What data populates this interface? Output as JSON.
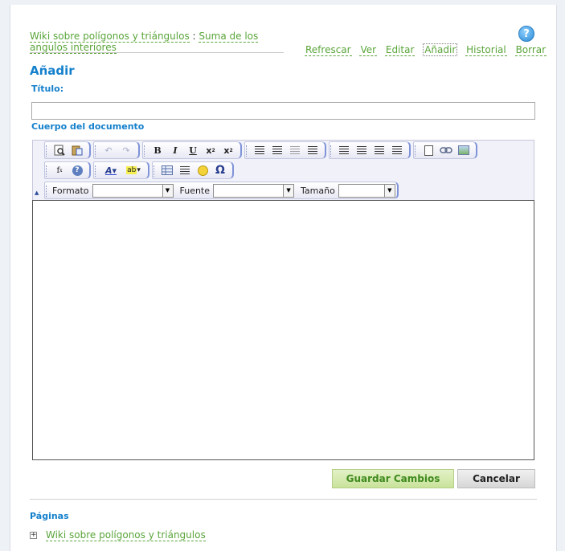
{
  "breadcrumb": {
    "wiki_link": "Wiki sobre polígonos y triángulos",
    "separator": ":",
    "page_link": "Suma de los angulos interiores"
  },
  "actions": [
    "Refrescar",
    "Ver",
    "Editar",
    "Añadir",
    "Historial",
    "Borrar"
  ],
  "active_action": "Añadir",
  "help_icon": "?",
  "heading": "Añadir",
  "title_label": "Título:",
  "title_value": "",
  "body_label": "Cuerpo del documento",
  "toolbar": {
    "icons_row1": [
      "preview-icon",
      "paste-word-icon",
      "undo-icon",
      "redo-icon",
      "bold-icon",
      "italic-icon",
      "underline-icon",
      "subscript-icon",
      "superscript-icon",
      "ordered-list-icon",
      "unordered-list-icon",
      "outdent-icon",
      "indent-icon",
      "align-left-icon",
      "align-center-icon",
      "align-right-icon",
      "justify-icon",
      "anchor-icon",
      "link-icon",
      "image-icon"
    ],
    "icons_row2": [
      "formula-icon",
      "about-icon",
      "text-color-icon",
      "background-color-icon",
      "table-icon",
      "horizontal-rule-icon",
      "smiley-icon",
      "special-char-icon"
    ],
    "format_label": "Formato",
    "font_label": "Fuente",
    "size_label": "Tamaño",
    "format_value": "",
    "font_value": "",
    "size_value": ""
  },
  "editor_content": "",
  "buttons": {
    "save": "Guardar Cambios",
    "cancel": "Cancelar"
  },
  "pages_heading": "Páginas",
  "pages_tree": [
    {
      "toggle": "+",
      "label": "Wiki sobre polígonos y triángulos"
    }
  ]
}
